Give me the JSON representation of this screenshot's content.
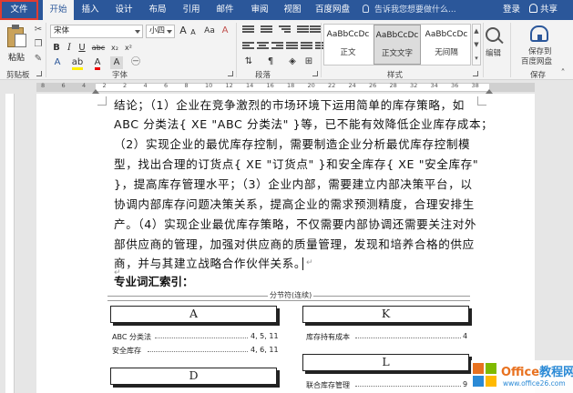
{
  "tabs": {
    "file": "文件",
    "home": "开始",
    "insert": "插入",
    "design": "设计",
    "layout": "布局",
    "references": "引用",
    "mailings": "邮件",
    "review": "审阅",
    "view": "视图",
    "baidu": "百度网盘",
    "tell_me": "告诉我您想要做什么...",
    "login": "登录",
    "share": "共享"
  },
  "ribbon": {
    "clipboard": {
      "paste": "粘贴",
      "label": "剪贴板"
    },
    "font": {
      "name": "宋体",
      "size": "小四",
      "label": "字体"
    },
    "paragraph": {
      "label": "段落"
    },
    "styles": {
      "label": "样式",
      "items": [
        {
          "sample": "AaBbCcDc",
          "name": "正文"
        },
        {
          "sample": "AaBbCcDc",
          "name": "正文文字"
        },
        {
          "sample": "AaBbCcDc",
          "name": "无间隔"
        }
      ]
    },
    "editing": {
      "label": "编辑"
    },
    "save": {
      "line1": "保存到",
      "line2": "百度网盘",
      "label": "保存"
    }
  },
  "ruler": {
    "numbers": [
      "8",
      "6",
      "4",
      "2",
      "2",
      "4",
      "6",
      "8",
      "10",
      "12",
      "14",
      "16",
      "18",
      "20",
      "22",
      "24",
      "26",
      "28",
      "32",
      "34",
      "36",
      "38"
    ]
  },
  "document": {
    "lines": [
      "结论；（1）企业在竞争激烈的市场环境下运用简单的库存策略，如",
      "ABC 分类法{ XE \"ABC 分类法\" }等，已不能有效降低企业库存成本；",
      "（2）实现企业的最优库存控制，需要制造企业分析最优库存控制模",
      "型，找出合理的订货点{ XE \"订货点\" }和安全库存{ XE \"安全库存\"",
      "}，提高库存管理水平；（3）企业内部，需要建立内部决策平台，以",
      "协调内部库存问题决策关系，提高企业的需求预测精度，合理安排生",
      "产。（4）实现企业最优库存策略，不仅需要内部协调还需要关注对外",
      "部供应商的管理，加强对供应商的质量管理，发现和培养合格的供应",
      "商，并与其建立战略合作伙伴关系。"
    ],
    "heading": "专业词汇索引：",
    "section_break": "分节符(连续)",
    "index": {
      "left": {
        "A": {
          "letter": "A",
          "entries": [
            {
              "term": "ABC 分类法",
              "pages": "4, 5, 11"
            },
            {
              "term": "安全库存",
              "pages": "4, 6, 11"
            }
          ]
        },
        "D": {
          "letter": "D"
        }
      },
      "right": {
        "K": {
          "letter": "K",
          "entries": [
            {
              "term": "库存持有成本",
              "pages": "4"
            }
          ]
        },
        "L": {
          "letter": "L",
          "entries": [
            {
              "term": "联合库存管理",
              "pages": "9"
            }
          ]
        }
      }
    }
  },
  "watermark": {
    "brand": "Office",
    "brand_suffix": "教程网",
    "url": "www.office26.com"
  }
}
